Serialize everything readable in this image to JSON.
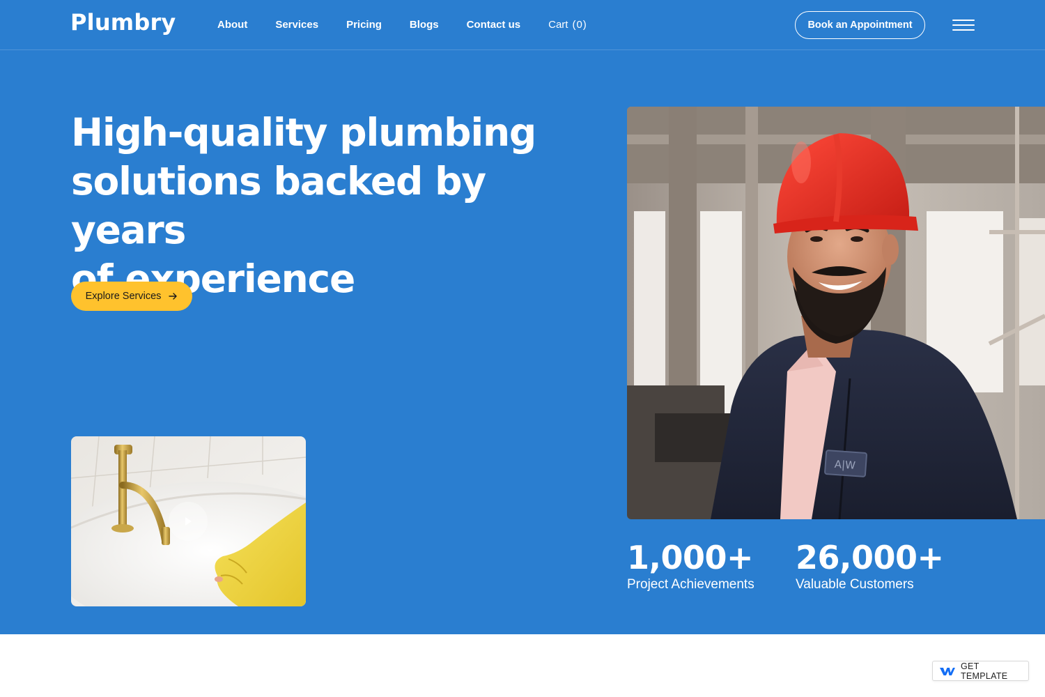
{
  "brand": {
    "name": "Plumbry"
  },
  "nav": {
    "links": [
      "About",
      "Services",
      "Pricing",
      "Blogs",
      "Contact us"
    ],
    "cart_label": "Cart",
    "cart_count": "(0)",
    "book_button": "Book an Appointment"
  },
  "hero": {
    "headline_lines": [
      "High-quality plumbing",
      "solutions backed by years",
      "of experience"
    ],
    "cta_label": "Explore Services"
  },
  "stats": [
    {
      "number": "1,000+",
      "label": "Project Achievements"
    },
    {
      "number": "26,000+",
      "label": "Valuable Customers"
    }
  ],
  "badge": {
    "label": "GET TEMPLATE"
  },
  "colors": {
    "hero_bg": "#2a7ed0",
    "accent_yellow": "#ffc22d",
    "text_light": "#ffffff"
  },
  "icons": [
    "menu-icon",
    "arrow-right-icon",
    "play-icon",
    "webflow-logo-icon"
  ]
}
